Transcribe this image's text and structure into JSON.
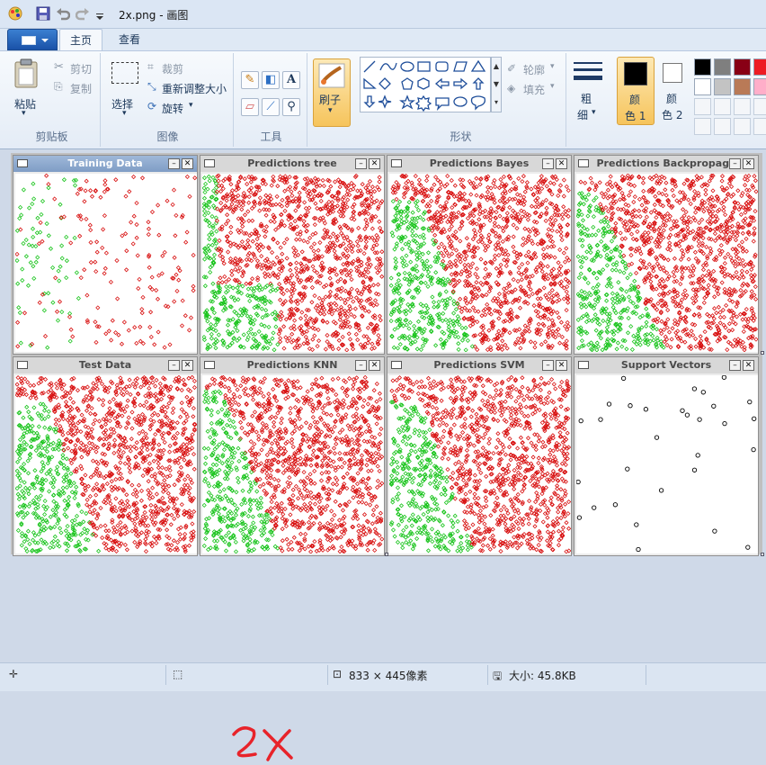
{
  "window": {
    "title": "2x.png - 画图"
  },
  "tabs": {
    "home": "主页",
    "view": "查看"
  },
  "clipboard": {
    "paste": "粘贴",
    "cut": "剪切",
    "copy": "复制",
    "group": "剪贴板"
  },
  "image": {
    "select": "选择",
    "crop": "裁剪",
    "resize": "重新调整大小",
    "rotate": "旋转",
    "group": "图像"
  },
  "tools": {
    "group": "工具"
  },
  "brushes": {
    "label": "刷子"
  },
  "shapes": {
    "outline": "轮廓",
    "fill": "填充",
    "group": "形状"
  },
  "size": {
    "label_1": "粗",
    "label_2": "细"
  },
  "colors": {
    "color1_a": "颜",
    "color1_b": "色 1",
    "color2_a": "颜",
    "color2_b": "色 2",
    "color1": "#000000",
    "color2": "#ffffff",
    "palette_row1": [
      "#000000",
      "#7f7f7f",
      "#880015",
      "#ed1c24"
    ],
    "palette_row2": [
      "#ffffff",
      "#c3c3c3",
      "#b97a57",
      "#ffaec9"
    ]
  },
  "panels": [
    {
      "title": "Training Data",
      "kind": "training",
      "active": true
    },
    {
      "title": "Predictions tree",
      "kind": "tree"
    },
    {
      "title": "Predictions Bayes",
      "kind": "bayes"
    },
    {
      "title": "Predictions Backpropaga",
      "kind": "bp"
    },
    {
      "title": "Test Data",
      "kind": "test"
    },
    {
      "title": "Predictions KNN",
      "kind": "knn"
    },
    {
      "title": "Predictions SVM",
      "kind": "svm"
    },
    {
      "title": "Support Vectors",
      "kind": "sv"
    }
  ],
  "annotation": {
    "text": "2X",
    "color": "#e8232a"
  },
  "status": {
    "dimensions": "833 × 445像素",
    "size": "大小: 45.8KB"
  }
}
